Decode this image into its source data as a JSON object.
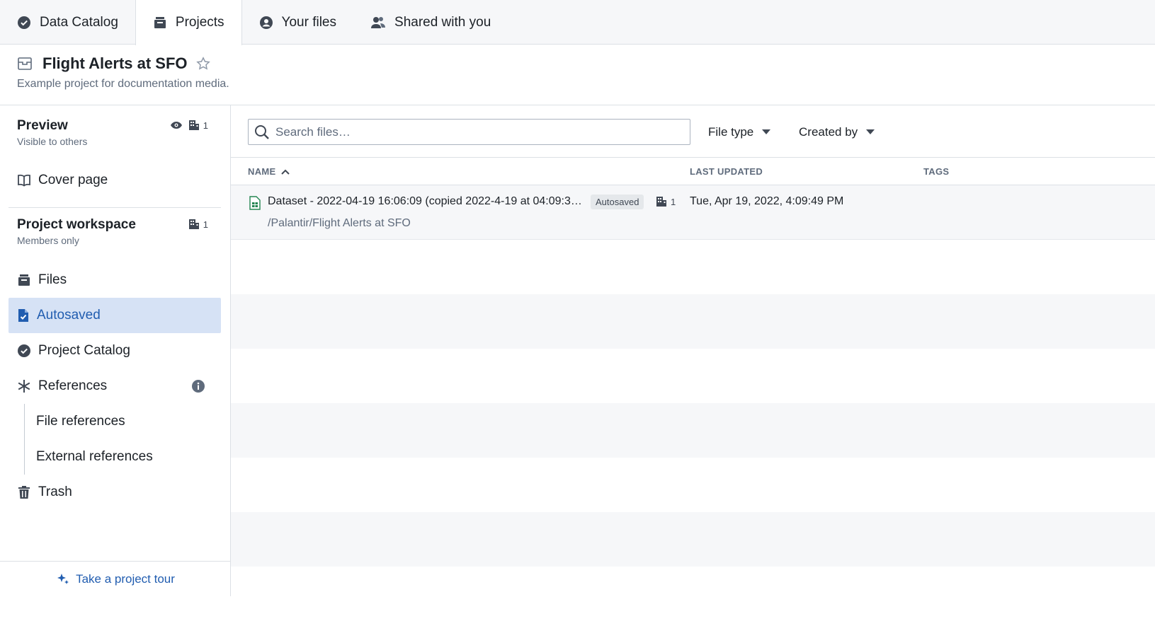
{
  "tabs": [
    {
      "label": "Data Catalog",
      "icon": "badge-check-icon"
    },
    {
      "label": "Projects",
      "icon": "projects-icon",
      "active": true
    },
    {
      "label": "Your files",
      "icon": "user-circle-icon"
    },
    {
      "label": "Shared with you",
      "icon": "people-icon"
    }
  ],
  "project": {
    "title": "Flight Alerts at SFO",
    "description": "Example project for documentation media."
  },
  "sidebar": {
    "preview": {
      "title": "Preview",
      "subtitle": "Visible to others",
      "group_count": "1"
    },
    "cover_page": "Cover page",
    "workspace": {
      "title": "Project workspace",
      "subtitle": "Members only",
      "group_count": "1"
    },
    "items": {
      "files": "Files",
      "autosaved": "Autosaved",
      "project_catalog": "Project Catalog",
      "references": "References",
      "file_references": "File references",
      "external_references": "External references",
      "trash": "Trash"
    },
    "tour": "Take a project tour"
  },
  "toolbar": {
    "search_placeholder": "Search files…",
    "file_type": "File type",
    "created_by": "Created by"
  },
  "table": {
    "columns": {
      "name": "NAME",
      "last_updated": "LAST UPDATED",
      "tags": "TAGS"
    },
    "rows": [
      {
        "name": "Dataset - 2022-04-19 16:06:09 (copied 2022-4-19 at 04:09:39 …",
        "badge": "Autosaved",
        "group_count": "1",
        "path": "/Palantir/Flight Alerts at SFO",
        "last_updated": "Tue, Apr 19, 2022, 4:09:49 PM"
      }
    ]
  },
  "colors": {
    "accent": "#215db0",
    "selected_bg": "#d6e2f5",
    "dataset_icon": "#238551"
  }
}
